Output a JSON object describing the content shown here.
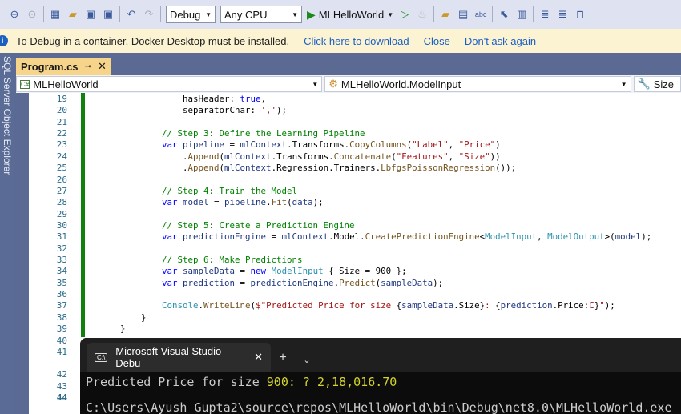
{
  "toolbar": {
    "config": "Debug",
    "platform": "Any CPU",
    "run_target": "MLHelloWorld"
  },
  "infobar": {
    "message": "To Debug in a container, Docker Desktop must be installed.",
    "download": "Click here to download",
    "close": "Close",
    "dont_ask": "Don't ask again"
  },
  "side_panel": "SQL Server Object Explorer",
  "tab": {
    "label": "Program.cs"
  },
  "nav": {
    "project": "MLHelloWorld",
    "type": "MLHelloWorld.ModelInput",
    "member": "Size"
  },
  "lines": [
    {
      "n": "19",
      "t": [
        [
          "pl",
          "                    hasHeader: "
        ],
        [
          "kw",
          "true"
        ],
        [
          "pl",
          ","
        ]
      ]
    },
    {
      "n": "20",
      "t": [
        [
          "pl",
          "                    separatorChar: "
        ],
        [
          "st",
          "','"
        ],
        [
          "pl",
          ");"
        ]
      ]
    },
    {
      "n": "21",
      "t": []
    },
    {
      "n": "22",
      "t": [
        [
          "cm",
          "                // Step 3: Define the Learning Pipeline"
        ]
      ]
    },
    {
      "n": "23",
      "t": [
        [
          "kw",
          "                var "
        ],
        [
          "lo",
          "pipeline"
        ],
        [
          "pl",
          " = "
        ],
        [
          "lo",
          "mlContext"
        ],
        [
          "pl",
          ".Transforms."
        ],
        [
          "me",
          "CopyColumns"
        ],
        [
          "pl",
          "("
        ],
        [
          "st",
          "\"Label\""
        ],
        [
          "pl",
          ", "
        ],
        [
          "st",
          "\"Price\""
        ],
        [
          "pl",
          ")"
        ]
      ]
    },
    {
      "n": "24",
      "t": [
        [
          "pl",
          "                    ."
        ],
        [
          "me",
          "Append"
        ],
        [
          "pl",
          "("
        ],
        [
          "lo",
          "mlContext"
        ],
        [
          "pl",
          ".Transforms."
        ],
        [
          "me",
          "Concatenate"
        ],
        [
          "pl",
          "("
        ],
        [
          "st",
          "\"Features\""
        ],
        [
          "pl",
          ", "
        ],
        [
          "st",
          "\"Size\""
        ],
        [
          "pl",
          "))"
        ]
      ]
    },
    {
      "n": "25",
      "t": [
        [
          "pl",
          "                    ."
        ],
        [
          "me",
          "Append"
        ],
        [
          "pl",
          "("
        ],
        [
          "lo",
          "mlContext"
        ],
        [
          "pl",
          ".Regression.Trainers."
        ],
        [
          "me",
          "LbfgsPoissonRegression"
        ],
        [
          "pl",
          "());"
        ]
      ]
    },
    {
      "n": "26",
      "t": []
    },
    {
      "n": "27",
      "t": [
        [
          "cm",
          "                // Step 4: Train the Model"
        ]
      ]
    },
    {
      "n": "28",
      "t": [
        [
          "kw",
          "                var "
        ],
        [
          "lo",
          "model"
        ],
        [
          "pl",
          " = "
        ],
        [
          "lo",
          "pipeline"
        ],
        [
          "pl",
          "."
        ],
        [
          "me",
          "Fit"
        ],
        [
          "pl",
          "("
        ],
        [
          "lo",
          "data"
        ],
        [
          "pl",
          ");"
        ]
      ]
    },
    {
      "n": "29",
      "t": []
    },
    {
      "n": "30",
      "t": [
        [
          "cm",
          "                // Step 5: Create a Prediction Engine"
        ]
      ]
    },
    {
      "n": "31",
      "t": [
        [
          "kw",
          "                var "
        ],
        [
          "lo",
          "predictionEngine"
        ],
        [
          "pl",
          " = "
        ],
        [
          "lo",
          "mlContext"
        ],
        [
          "pl",
          ".Model."
        ],
        [
          "me",
          "CreatePredictionEngine"
        ],
        [
          "pl",
          "<"
        ],
        [
          "ty",
          "ModelInput"
        ],
        [
          "pl",
          ", "
        ],
        [
          "ty",
          "ModelOutput"
        ],
        [
          "pl",
          ">("
        ],
        [
          "lo",
          "model"
        ],
        [
          "pl",
          ");"
        ]
      ]
    },
    {
      "n": "32",
      "t": []
    },
    {
      "n": "33",
      "t": [
        [
          "cm",
          "                // Step 6: Make Predictions"
        ]
      ]
    },
    {
      "n": "34",
      "t": [
        [
          "kw",
          "                var "
        ],
        [
          "lo",
          "sampleData"
        ],
        [
          "pl",
          " = "
        ],
        [
          "kw",
          "new "
        ],
        [
          "ty",
          "ModelInput"
        ],
        [
          "pl",
          " { Size = 900 };"
        ]
      ]
    },
    {
      "n": "35",
      "t": [
        [
          "kw",
          "                var "
        ],
        [
          "lo",
          "prediction"
        ],
        [
          "pl",
          " = "
        ],
        [
          "lo",
          "predictionEngine"
        ],
        [
          "pl",
          "."
        ],
        [
          "me",
          "Predict"
        ],
        [
          "pl",
          "("
        ],
        [
          "lo",
          "sampleData"
        ],
        [
          "pl",
          ");"
        ]
      ]
    },
    {
      "n": "36",
      "t": []
    },
    {
      "n": "37",
      "t": [
        [
          "ty",
          "                Console"
        ],
        [
          "pl",
          "."
        ],
        [
          "me",
          "WriteLine"
        ],
        [
          "pl",
          "("
        ],
        [
          "st",
          "$\"Predicted Price for size "
        ],
        [
          "pl",
          "{"
        ],
        [
          "lo",
          "sampleData"
        ],
        [
          "pl",
          ".Size}"
        ],
        [
          "st",
          ": "
        ],
        [
          "pl",
          "{"
        ],
        [
          "lo",
          "prediction"
        ],
        [
          "pl",
          ".Price:"
        ],
        [
          "st",
          "C"
        ],
        [
          "pl",
          "}"
        ],
        [
          "st",
          "\""
        ],
        [
          "pl",
          ");"
        ]
      ]
    },
    {
      "n": "38",
      "t": [
        [
          "pl",
          "            }"
        ]
      ]
    },
    {
      "n": "39",
      "t": [
        [
          "pl",
          "        }"
        ]
      ]
    },
    {
      "n": "40",
      "t": []
    },
    {
      "n": "41",
      "t": []
    }
  ],
  "extra_line_numbers": [
    "42",
    "43",
    "44"
  ],
  "terminal": {
    "tab_title": "Microsoft Visual Studio Debu",
    "output_prefix": "Predicted Price for size ",
    "output_value": "900: ? 2,18,016.70",
    "path": "C:\\Users\\Ayush Gupta2\\source\\repos\\MLHelloWorld\\bin\\Debug\\net8.0\\MLHelloWorld.exe"
  }
}
